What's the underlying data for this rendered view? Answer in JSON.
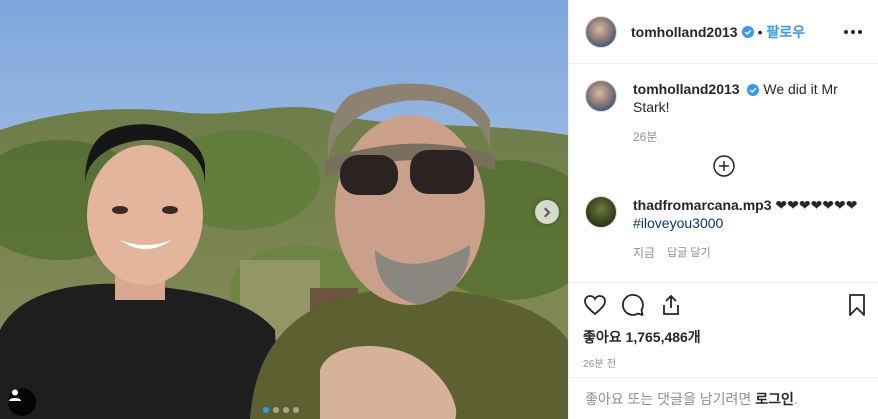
{
  "post": {
    "author": "tomholland2013",
    "follow_label": "팔로우",
    "separator": "•",
    "caption": "We did it Mr Stark!",
    "caption_time": "26분",
    "likes_label": "좋아요 1,765,486개",
    "posted_time": "26분 전",
    "carousel_count": 4,
    "carousel_active_index": 0
  },
  "comment": {
    "author": "thadfromarcana.mp3",
    "text": "❤❤❤❤❤❤❤",
    "hashtag": "#iloveyou3000",
    "time": "지금",
    "reply_label": "답글 달기"
  },
  "footer": {
    "prompt": "좋아요 또는 댓글을 남기려면",
    "login_label": "로그인",
    "period": "."
  },
  "colors": {
    "link_blue": "#3897f0",
    "hashtag": "#00376b",
    "muted": "#8e8e8e",
    "text": "#262626"
  },
  "icons": [
    "more-options-icon",
    "verified-badge-icon",
    "add-circle-icon",
    "heart-icon",
    "comment-icon",
    "share-icon",
    "bookmark-icon",
    "chevron-right-icon",
    "user-tag-icon"
  ]
}
